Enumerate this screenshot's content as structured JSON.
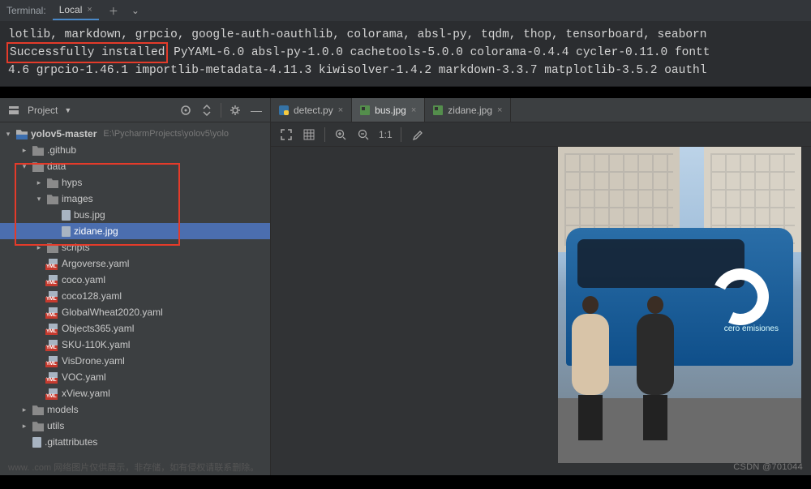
{
  "terminal": {
    "header_label": "Terminal:",
    "tab_label": "Local",
    "line1": "lotlib, markdown, grpcio, google-auth-oauthlib, colorama, absl-py, tqdm, thop, tensorboard, seaborn",
    "highlight": "Successfully installed",
    "line2_rest": " PyYAML-6.0 absl-py-1.0.0 cachetools-5.0.0 colorama-0.4.4 cycler-0.11.0 fontt",
    "line3": "4.6 grpcio-1.46.1 importlib-metadata-4.11.3 kiwisolver-1.4.2 markdown-3.3.7 matplotlib-3.5.2 oauthl"
  },
  "project": {
    "panel_label": "Project",
    "root": "yolov5-master",
    "root_path": "E:\\PycharmProjects\\yolov5\\yolo",
    "tree": [
      {
        "name": ".github",
        "type": "folder",
        "indent": 1,
        "chev": "closed"
      },
      {
        "name": "data",
        "type": "folder",
        "indent": 1,
        "chev": "open"
      },
      {
        "name": "hyps",
        "type": "folder",
        "indent": 2,
        "chev": "closed"
      },
      {
        "name": "images",
        "type": "folder",
        "indent": 2,
        "chev": "open"
      },
      {
        "name": "bus.jpg",
        "type": "image",
        "indent": 3,
        "chev": "none"
      },
      {
        "name": "zidane.jpg",
        "type": "image",
        "indent": 3,
        "chev": "none",
        "selected": true
      },
      {
        "name": "scripts",
        "type": "folder",
        "indent": 2,
        "chev": "closed"
      },
      {
        "name": "Argoverse.yaml",
        "type": "yaml",
        "indent": 2,
        "chev": "none"
      },
      {
        "name": "coco.yaml",
        "type": "yaml",
        "indent": 2,
        "chev": "none"
      },
      {
        "name": "coco128.yaml",
        "type": "yaml",
        "indent": 2,
        "chev": "none"
      },
      {
        "name": "GlobalWheat2020.yaml",
        "type": "yaml",
        "indent": 2,
        "chev": "none"
      },
      {
        "name": "Objects365.yaml",
        "type": "yaml",
        "indent": 2,
        "chev": "none"
      },
      {
        "name": "SKU-110K.yaml",
        "type": "yaml",
        "indent": 2,
        "chev": "none"
      },
      {
        "name": "VisDrone.yaml",
        "type": "yaml",
        "indent": 2,
        "chev": "none"
      },
      {
        "name": "VOC.yaml",
        "type": "yaml",
        "indent": 2,
        "chev": "none"
      },
      {
        "name": "xView.yaml",
        "type": "yaml",
        "indent": 2,
        "chev": "none"
      },
      {
        "name": "models",
        "type": "folder",
        "indent": 1,
        "chev": "closed"
      },
      {
        "name": "utils",
        "type": "folder",
        "indent": 1,
        "chev": "closed"
      },
      {
        "name": ".gitattributes",
        "type": "file",
        "indent": 1,
        "chev": "none"
      }
    ]
  },
  "editor": {
    "tabs": [
      {
        "label": "detect.py",
        "icon": "py",
        "active": false
      },
      {
        "label": "bus.jpg",
        "icon": "img",
        "active": true
      },
      {
        "label": "zidane.jpg",
        "icon": "img",
        "active": false
      }
    ],
    "zoom_label": "1:1",
    "bus_text": "cero\nemisiones"
  },
  "watermark": "CSDN @701044",
  "watermark2": "www.        .com 网络图片仅供展示，非存储，如有侵权请联系删除。"
}
